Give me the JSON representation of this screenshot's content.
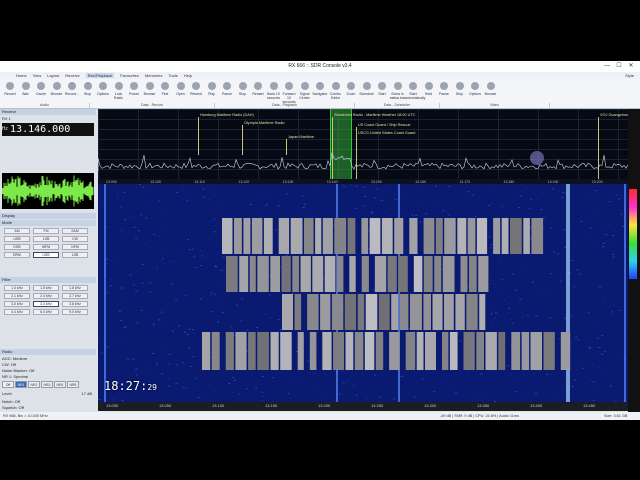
{
  "window": {
    "title": "RX 666 :: SDR Console v3.4",
    "style_label": "Style",
    "minimize": "—",
    "maximize": "☐",
    "close": "✕"
  },
  "menu": [
    "Home",
    "View",
    "Layout",
    "Receive",
    "Rec/Playback",
    "Favourites",
    "Memories",
    "Tools",
    "Help"
  ],
  "menu_active": 4,
  "ribbon": {
    "buttons": [
      "Record",
      "Wav",
      "Cache",
      "Browse",
      "Record...",
      "Stop",
      "Options",
      "Lock Radio",
      "Power",
      "Browse",
      "First",
      "Open",
      "Rewind",
      "Play",
      "Pause",
      "Stop",
      "Restart",
      "Back 10 seconds",
      "Forward 10 seconds",
      "Signal Center",
      "Navigator",
      "Combo Editor",
      "Zoom",
      "Schedule",
      "Start",
      "Show in status bar",
      "Start automatically",
      "Hold",
      "Pause",
      "Stop",
      "Options",
      "Browse"
    ],
    "groups": [
      "Audio",
      "Data - Record",
      "Data - Playback",
      "Data - Scheduler",
      "Video"
    ]
  },
  "meter": {
    "r1": "S6",
    "r2": "80 dB"
  },
  "left": {
    "receive_header": "Receive",
    "rx_label": "RX 1",
    "freq_prefix": "Hz",
    "frequency": "13.146.000",
    "display_header": "Display",
    "mode_header": "Mode",
    "mode_buttons": [
      "AM",
      "FM",
      "SAM",
      "USB",
      "LSB",
      "CW",
      "DSB",
      "WFM",
      "NFM",
      "DRM",
      "USB",
      "LSB"
    ],
    "filter_header": "Filter",
    "filter_buttons": [
      "1.0 kHz",
      "1.5 kHz",
      "1.8 kHz",
      "2.1 kHz",
      "2.4 kHz",
      "2.7 kHz",
      "3.0 kHz",
      "3.4 kHz",
      "3.8 kHz",
      "4.4 kHz",
      "6.0 kHz",
      "9.0 kHz"
    ],
    "radio_header": "Radio",
    "info": [
      "AGC: Medium",
      "CW: Off",
      "Noise Blanker: Off",
      "NR 1: Spectral"
    ],
    "mode_tabs": [
      "Off",
      "NR1",
      "NR2",
      "NR3",
      "NR4",
      "NR5"
    ],
    "level_label": "Level",
    "level_value": "17 dB",
    "bottom_rows": [
      "Notch: Off",
      "Squelch: Off"
    ]
  },
  "spectrum": {
    "labels": [
      {
        "text": "Hamburg Maritime Radio (DAH)"
      },
      {
        "text": "Olympia Maritime Radio"
      },
      {
        "text": "Japan Maritime"
      },
      {
        "text": "Stockholm Radio - Maritime Weather 18:00 UTC"
      },
      {
        "text": "US Coast Guard / Ship Rescue"
      },
      {
        "text": "USCG United States Coast Guard"
      },
      {
        "text": "VOJ Guangzhou"
      }
    ],
    "freq_ticks": [
      "13.090",
      "13.100",
      "13.110",
      "13.120",
      "13.130",
      "13.140",
      "13.150",
      "13.160",
      "13.170",
      "13.180",
      "13.190",
      "13.200"
    ]
  },
  "clock": {
    "hm": "18:27",
    "s": "29"
  },
  "bottom_ticks": [
    "13.000",
    "13.050",
    "13.100",
    "13.150",
    "13.200",
    "13.250",
    "13.300",
    "13.350",
    "13.400",
    "13.450"
  ],
  "status": {
    "left": "RX 666, Bw = 10.000 MHz",
    "mid": "-49 dB | SNR: 9 dB | CPU: 24.6% | Audio 11ms",
    "right": "Size: 3.61 GB"
  }
}
